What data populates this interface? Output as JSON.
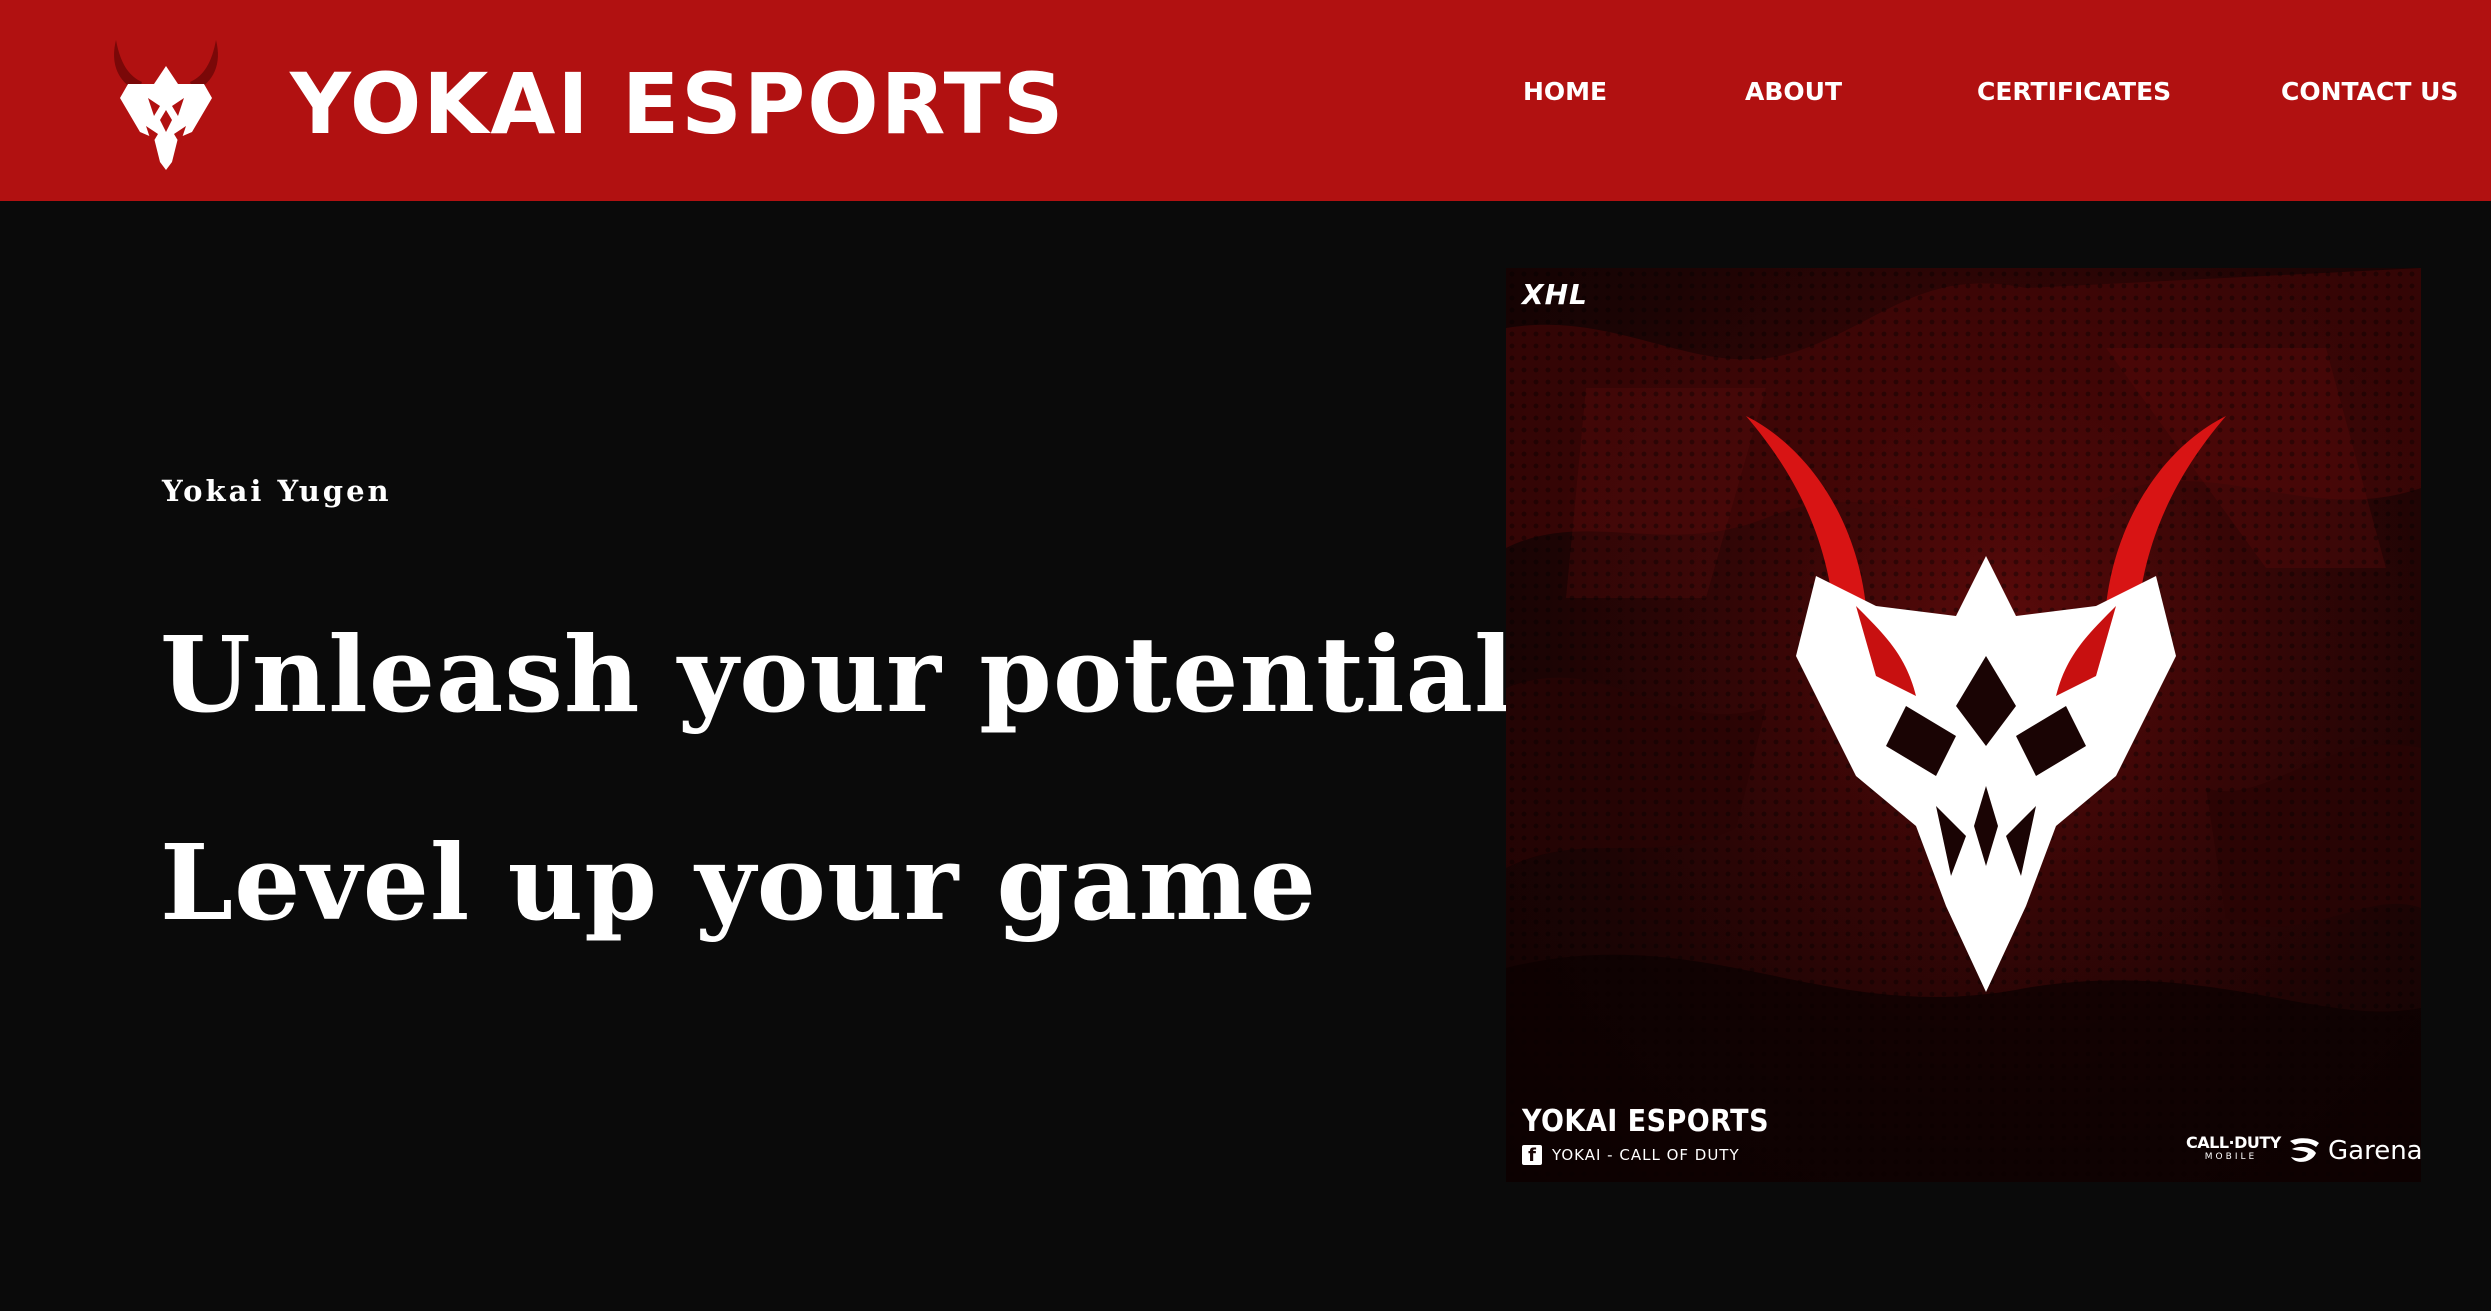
{
  "header": {
    "brand": "YOKAI ESPORTS",
    "logo_icon": "oni-mask-icon",
    "background_color": "#b11111",
    "nav": [
      {
        "label": "HOME"
      },
      {
        "label": "ABOUT"
      },
      {
        "label": "CERTIFICATES"
      },
      {
        "label": "CONTACT US"
      }
    ]
  },
  "hero": {
    "eyebrow": "Yokai Yugen",
    "headline_1": "Unleash your potential",
    "headline_2": "Level up your game"
  },
  "poster": {
    "corner_tag": "XHL",
    "team_name": "YOKAI ESPORTS",
    "social_icon": "facebook-icon",
    "social_text": "YOKAI - CALL OF DUTY",
    "partner_1_line_1": "CALL·DUTY",
    "partner_1_line_2": "MOBILE",
    "partner_2": "Garena",
    "accent_color": "#c01212"
  }
}
